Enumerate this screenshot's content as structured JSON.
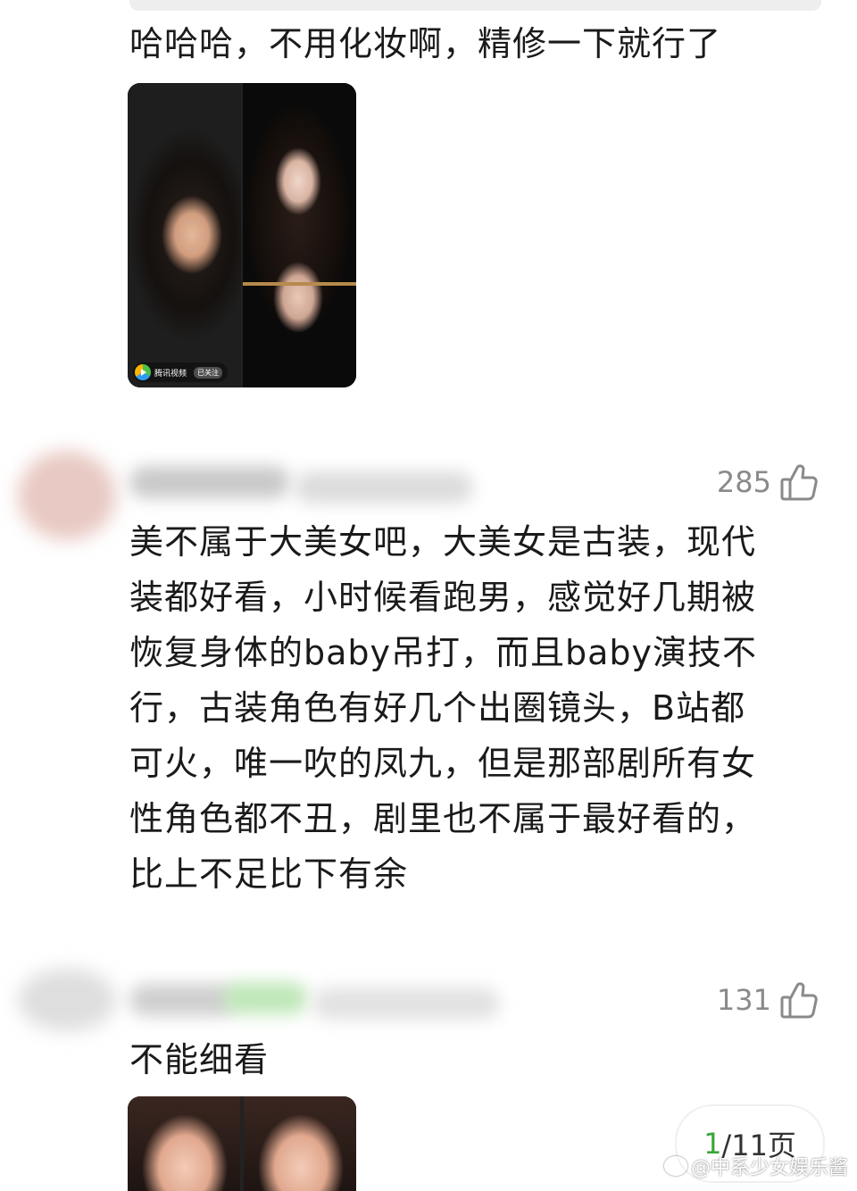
{
  "comments": [
    {
      "text": "哈哈哈，不用化妆啊，精修一下就行了",
      "image": {
        "source_label": "腾讯视频",
        "follow_label": "已关注"
      }
    },
    {
      "like_count": "285",
      "text": "美不属于大美女吧，大美女是古装，现代\n装都好看，小时候看跑男，感觉好几期被\n恢复身体的baby吊打，而且baby演技不\n行，古装角色有好几个出圈镜头，B站都\n可火，唯一吹的凤九，但是那部剧所有女\n性角色都不丑，剧里也不属于最好看的，\n比上不足比下有余"
    },
    {
      "like_count": "131",
      "text": "不能细看"
    }
  ],
  "pagination": {
    "current": "1",
    "rest": "/11页"
  },
  "watermark": {
    "text": "@中系少女娱乐酱"
  },
  "icons": {
    "like": "thumbs-up-icon",
    "video_logo": "tencent-video-icon",
    "weibo": "weibo-icon"
  }
}
